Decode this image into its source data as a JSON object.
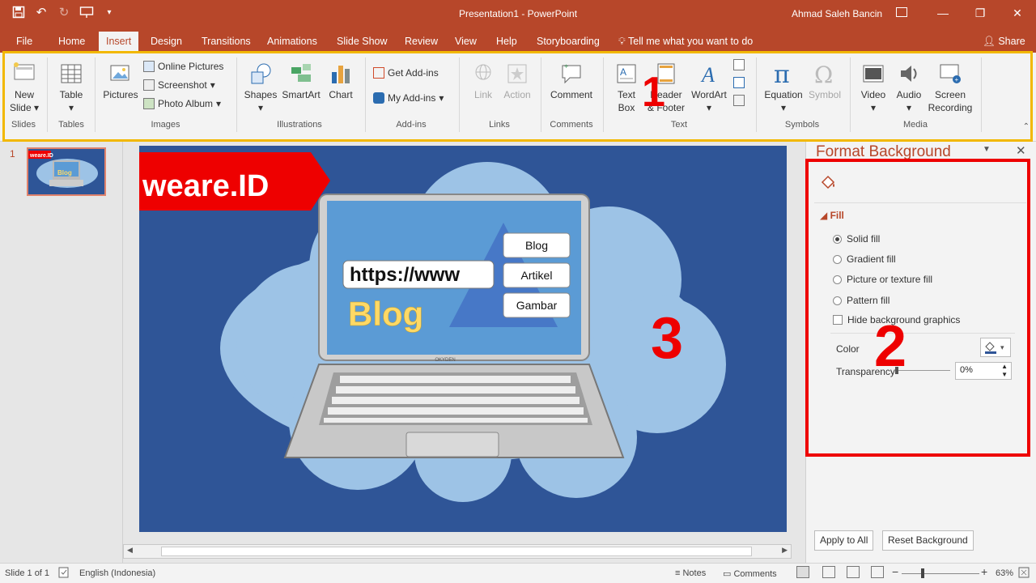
{
  "window": {
    "title": "Presentation1  -  PowerPoint",
    "user": "Ahmad Saleh Bancin"
  },
  "tabs": [
    "File",
    "Home",
    "Insert",
    "Design",
    "Transitions",
    "Animations",
    "Slide Show",
    "Review",
    "View",
    "Help",
    "Storyboarding"
  ],
  "active_tab": "Insert",
  "tellme": "Tell me what you want to do",
  "share": "Share",
  "ribbon": {
    "new_slide": "New",
    "new_slide2": "Slide",
    "slides_group": "Slides",
    "table": "Table",
    "tables_group": "Tables",
    "pictures": "Pictures",
    "online_pictures": "Online Pictures",
    "screenshot": "Screenshot",
    "photo_album": "Photo Album",
    "images_group": "Images",
    "shapes": "Shapes",
    "smartart": "SmartArt",
    "chart": "Chart",
    "illustrations_group": "Illustrations",
    "get_addins": "Get Add-ins",
    "my_addins": "My Add-ins",
    "addins_group": "Add-ins",
    "link": "Link",
    "action": "Action",
    "links_group": "Links",
    "comment": "Comment",
    "comments_group": "Comments",
    "text_box": "Text",
    "text_box2": "Box",
    "header_footer": "Header",
    "header_footer2": "& Footer",
    "wordart": "WordArt",
    "text_group": "Text",
    "equation": "Equation",
    "symbol": "Symbol",
    "symbols_group": "Symbols",
    "video": "Video",
    "audio": "Audio",
    "screen_recording": "Screen",
    "screen_recording2": "Recording",
    "media_group": "Media"
  },
  "annotations": {
    "one": "1",
    "two": "2",
    "three": "3"
  },
  "thumbnail": {
    "number": "1"
  },
  "slide": {
    "banner": "weare.ID",
    "url": "https://www",
    "blog": "Blog",
    "menu": [
      "Blog",
      "Artikel",
      "Gambar"
    ],
    "brand": "OKYDEN",
    "thumb_banner": "weare.ID",
    "thumb_blog": "Blog"
  },
  "format_pane": {
    "title": "Format Background",
    "fill": "Fill",
    "options": [
      "Solid fill",
      "Gradient fill",
      "Picture or texture fill",
      "Pattern fill"
    ],
    "selected": "Solid fill",
    "hide_bg": "Hide background graphics",
    "color": "Color",
    "transparency": "Transparency",
    "transparency_value": "0%",
    "apply_all": "Apply to All",
    "reset": "Reset Background"
  },
  "status": {
    "slide": "Slide 1 of 1",
    "language": "English (Indonesia)",
    "notes": "Notes",
    "comments": "Comments",
    "zoom": "63%"
  },
  "colors": {
    "accent": "#b7472a",
    "slide_bg": "#2f5597",
    "highlight_yellow": "#f2b800",
    "highlight_red": "#ee0000"
  }
}
